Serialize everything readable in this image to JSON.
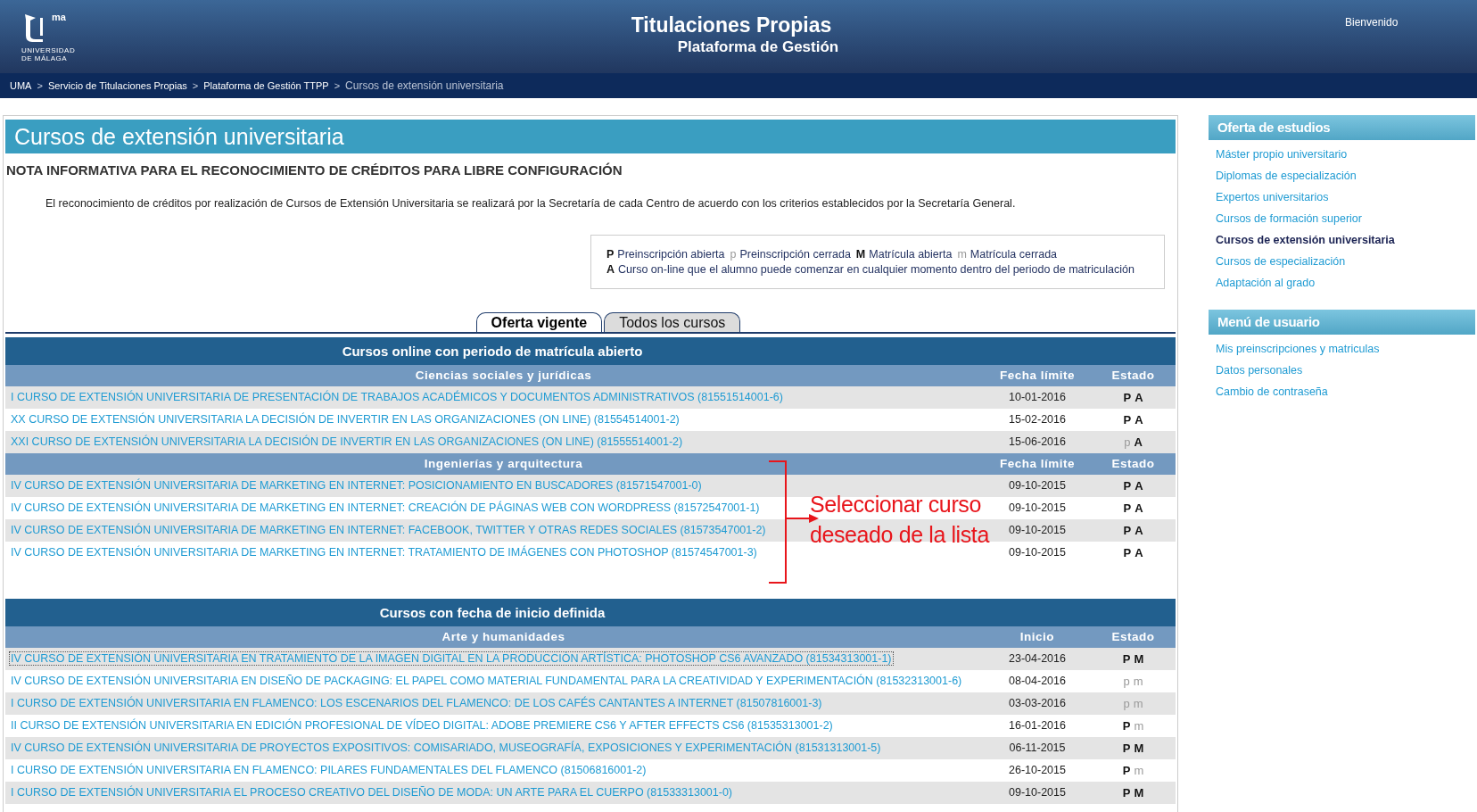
{
  "logo": {
    "mark": "ma",
    "lines": [
      "UNIVERSIDAD",
      "DE MÁLAGA"
    ]
  },
  "header": {
    "title": "Titulaciones Propias",
    "subtitle": "Plataforma de Gestión",
    "greeting": "Bienvenido"
  },
  "breadcrumb": {
    "separator": ">",
    "items": [
      {
        "label": "UMA",
        "current": false
      },
      {
        "label": "Servicio de Titulaciones Propias",
        "current": false
      },
      {
        "label": "Plataforma de Gestión TTPP",
        "current": false
      },
      {
        "label": "Cursos de extensión universitaria",
        "current": true
      }
    ]
  },
  "page_title": "Cursos de extensión universitaria",
  "notice": {
    "heading": "NOTA INFORMATIVA PARA EL RECONOCIMIENTO DE CRÉDITOS PARA LIBRE CONFIGURACIÓN",
    "text": "El reconocimiento de créditos por realización de Cursos de Extensión Universitaria se realizará por la Secretaría de cada Centro de acuerdo con los criterios establecidos por la Secretaría General."
  },
  "legend": {
    "lines": [
      [
        {
          "letter": "P",
          "open": true,
          "label": "Preinscripción abierta"
        },
        {
          "letter": "p",
          "open": false,
          "label": "Preinscripción cerrada"
        },
        {
          "letter": "M",
          "open": true,
          "label": "Matrícula abierta"
        },
        {
          "letter": "m",
          "open": false,
          "label": "Matrícula cerrada"
        }
      ],
      [
        {
          "letter": "A",
          "open": true,
          "label": "Curso on-line que el alumno puede comenzar en cualquier momento dentro del periodo de matriculación"
        }
      ]
    ]
  },
  "tabs": [
    {
      "label": "Oferta vigente",
      "selected": true
    },
    {
      "label": "Todos los cursos",
      "selected": false
    }
  ],
  "sections": [
    {
      "title": "Cursos online con periodo de matrícula abierto",
      "groups": [
        {
          "name": "Ciencias sociales y jurídicas",
          "columns": [
            "Fecha límite",
            "Estado"
          ],
          "rows": [
            {
              "course": "I CURSO DE EXTENSIÓN UNIVERSITARIA DE PRESENTACIÓN DE TRABAJOS ACADÉMICOS Y DOCUMENTOS ADMINISTRATIVOS (81551514001-6)",
              "date": "10-01-2016",
              "focused": false,
              "status": [
                {
                  "letter": "P",
                  "open": true
                },
                {
                  "letter": "A",
                  "open": true
                }
              ]
            },
            {
              "course": "XX CURSO DE EXTENSIÓN UNIVERSITARIA LA DECISIÓN DE INVERTIR EN LAS ORGANIZACIONES (ON LINE) (81554514001-2)",
              "date": "15-02-2016",
              "focused": false,
              "status": [
                {
                  "letter": "P",
                  "open": true
                },
                {
                  "letter": "A",
                  "open": true
                }
              ]
            },
            {
              "course": "XXI CURSO DE EXTENSIÓN UNIVERSITARIA LA DECISIÓN DE INVERTIR EN LAS ORGANIZACIONES (ON LINE) (81555514001-2)",
              "date": "15-06-2016",
              "focused": false,
              "status": [
                {
                  "letter": "p",
                  "open": false
                },
                {
                  "letter": "A",
                  "open": true
                }
              ]
            }
          ]
        },
        {
          "name": "Ingenierías y arquitectura",
          "columns": [
            "Fecha límite",
            "Estado"
          ],
          "rows": [
            {
              "course": "IV CURSO DE EXTENSIÓN UNIVERSITARIA DE MARKETING EN INTERNET: POSICIONAMIENTO EN BUSCADORES (81571547001-0)",
              "date": "09-10-2015",
              "focused": false,
              "status": [
                {
                  "letter": "P",
                  "open": true
                },
                {
                  "letter": "A",
                  "open": true
                }
              ]
            },
            {
              "course": "IV CURSO DE EXTENSIÓN UNIVERSITARIA DE MARKETING EN INTERNET: CREACIÓN DE PÁGINAS WEB CON WORDPRESS (81572547001-1)",
              "date": "09-10-2015",
              "focused": false,
              "status": [
                {
                  "letter": "P",
                  "open": true
                },
                {
                  "letter": "A",
                  "open": true
                }
              ]
            },
            {
              "course": "IV CURSO DE EXTENSIÓN UNIVERSITARIA DE MARKETING EN INTERNET: FACEBOOK, TWITTER Y OTRAS REDES SOCIALES (81573547001-2)",
              "date": "09-10-2015",
              "focused": false,
              "status": [
                {
                  "letter": "P",
                  "open": true
                },
                {
                  "letter": "A",
                  "open": true
                }
              ]
            },
            {
              "course": "IV CURSO DE EXTENSIÓN UNIVERSITARIA DE MARKETING EN INTERNET: TRATAMIENTO DE IMÁGENES CON PHOTOSHOP (81574547001-3)",
              "date": "09-10-2015",
              "focused": false,
              "status": [
                {
                  "letter": "P",
                  "open": true
                },
                {
                  "letter": "A",
                  "open": true
                }
              ]
            }
          ]
        }
      ]
    },
    {
      "title": "Cursos con fecha de inicio definida",
      "groups": [
        {
          "name": "Arte y humanidades",
          "columns": [
            "Inicio",
            "Estado"
          ],
          "rows": [
            {
              "course": "IV CURSO DE EXTENSIÓN UNIVERSITARIA EN TRATAMIENTO DE LA IMAGEN DIGITAL EN LA PRODUCCIÓN ARTÍSTICA: PHOTOSHOP CS6 AVANZADO (81534313001-1)",
              "date": "23-04-2016",
              "focused": true,
              "status": [
                {
                  "letter": "P",
                  "open": true
                },
                {
                  "letter": "M",
                  "open": true
                }
              ]
            },
            {
              "course": "IV CURSO DE EXTENSIÓN UNIVERSITARIA EN DISEÑO DE PACKAGING: EL PAPEL COMO MATERIAL FUNDAMENTAL PARA LA CREATIVIDAD Y EXPERIMENTACIÓN (81532313001-6)",
              "date": "08-04-2016",
              "focused": false,
              "status": [
                {
                  "letter": "p",
                  "open": false
                },
                {
                  "letter": "m",
                  "open": false
                }
              ]
            },
            {
              "course": "I CURSO DE EXTENSIÓN UNIVERSITARIA EN FLAMENCO: LOS ESCENARIOS DEL FLAMENCO: DE LOS CAFÉS CANTANTES A INTERNET (81507816001-3)",
              "date": "03-03-2016",
              "focused": false,
              "status": [
                {
                  "letter": "p",
                  "open": false
                },
                {
                  "letter": "m",
                  "open": false
                }
              ]
            },
            {
              "course": "II CURSO DE EXTENSIÓN UNIVERSITARIA EN EDICIÓN PROFESIONAL DE VÍDEO DIGITAL: ADOBE PREMIERE CS6 Y AFTER EFFECTS CS6 (81535313001-2)",
              "date": "16-01-2016",
              "focused": false,
              "status": [
                {
                  "letter": "P",
                  "open": true
                },
                {
                  "letter": "m",
                  "open": false
                }
              ]
            },
            {
              "course": "IV CURSO DE EXTENSIÓN UNIVERSITARIA DE PROYECTOS EXPOSITIVOS: COMISARIADO, MUSEOGRAFÍA, EXPOSICIONES Y EXPERIMENTACIÓN (81531313001-5)",
              "date": "06-11-2015",
              "focused": false,
              "status": [
                {
                  "letter": "P",
                  "open": true
                },
                {
                  "letter": "M",
                  "open": true
                }
              ]
            },
            {
              "course": "I CURSO DE EXTENSIÓN UNIVERSITARIA EN FLAMENCO: PILARES FUNDAMENTALES DEL FLAMENCO (81506816001-2)",
              "date": "26-10-2015",
              "focused": false,
              "status": [
                {
                  "letter": "P",
                  "open": true
                },
                {
                  "letter": "m",
                  "open": false
                }
              ]
            },
            {
              "course": "I CURSO DE EXTENSIÓN UNIVERSITARIA EL PROCESO CREATIVO DEL DISEÑO DE MODA: UN ARTE PARA EL CUERPO (81533313001-0)",
              "date": "09-10-2015",
              "focused": false,
              "status": [
                {
                  "letter": "P",
                  "open": true
                },
                {
                  "letter": "M",
                  "open": true
                }
              ]
            }
          ]
        }
      ]
    }
  ],
  "annotation": {
    "lines": [
      "Seleccionar curso",
      "deseado de la lista"
    ]
  },
  "sidebar": [
    {
      "title": "Oferta de estudios",
      "items": [
        {
          "label": "Máster propio universitario",
          "selected": false
        },
        {
          "label": "Diplomas de especialización",
          "selected": false
        },
        {
          "label": "Expertos universitarios",
          "selected": false
        },
        {
          "label": "Cursos de formación superior",
          "selected": false
        },
        {
          "label": "Cursos de extensión universitaria",
          "selected": true
        },
        {
          "label": "Cursos de especialización",
          "selected": false
        },
        {
          "label": "Adaptación al grado",
          "selected": false
        }
      ]
    },
    {
      "title": "Menú de usuario",
      "items": [
        {
          "label": "Mis preinscripciones y matriculas",
          "selected": false
        },
        {
          "label": "Datos personales",
          "selected": false
        },
        {
          "label": "Cambio de contraseña",
          "selected": false
        }
      ]
    }
  ]
}
